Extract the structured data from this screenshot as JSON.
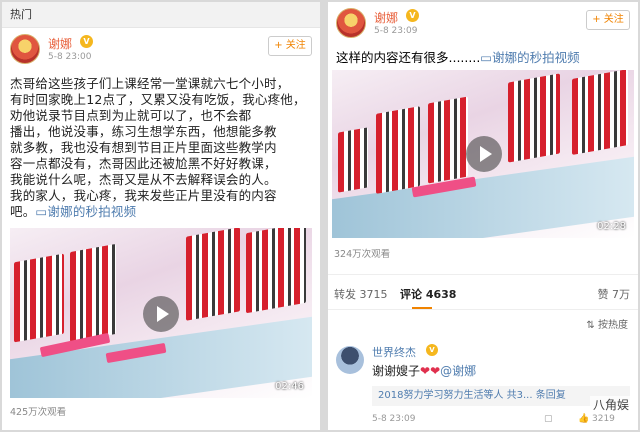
{
  "left": {
    "section_label": "热门",
    "user": {
      "name": "谢娜",
      "time": "5-8 23:00",
      "follow": "+ 关注"
    },
    "post_lines": [
      "杰哥给这些孩子们上课经常一堂课就六七个小时，",
      "有时回家晚上12点了，又累又没有吃饭，我心疼他，",
      "劝他说录节目点到为止就可以了，也不会都",
      "播出，他说没事，练习生想学东西，他想能多教",
      "就多教，我也没有想到节目正片里面这些教学内",
      "容一点都没有，杰哥因此还被尬黑不好好教课，",
      "我能说什么呢，杰哥又是从不去解释误会的人。",
      "我的家人，我心疼，我来发些正片里没有的内容",
      "吧。"
    ],
    "video_link": "谢娜的秒拍视频",
    "video_duration": "02:46",
    "views": "425万次观看"
  },
  "right": {
    "user": {
      "name": "谢娜",
      "time": "5-8 23:09",
      "follow": "+ 关注"
    },
    "post_text": "这样的内容还有很多........",
    "video_link": "谢娜的秒拍视频",
    "video_duration": "02:28",
    "views": "324万次观看",
    "stats": {
      "repost": "转发 3715",
      "comment": "评论 4638",
      "like": "赞 7万"
    },
    "sort": "按热度",
    "comment": {
      "name": "世界终杰",
      "text": "谢谢嫂子",
      "mention": "@谢娜",
      "reply_summary": "2018努力学习努力生活等人  共3... 条回复",
      "time": "5-8 23:09",
      "like_count": "3219",
      "watermark": "八角娱"
    }
  },
  "colors": {
    "accent": "#f08300",
    "username": "#e8603c",
    "link": "#507daf"
  },
  "icons": [
    "vip-badge-icon",
    "play-icon",
    "video-link-icon",
    "comment-icon",
    "like-icon",
    "sort-icon"
  ]
}
